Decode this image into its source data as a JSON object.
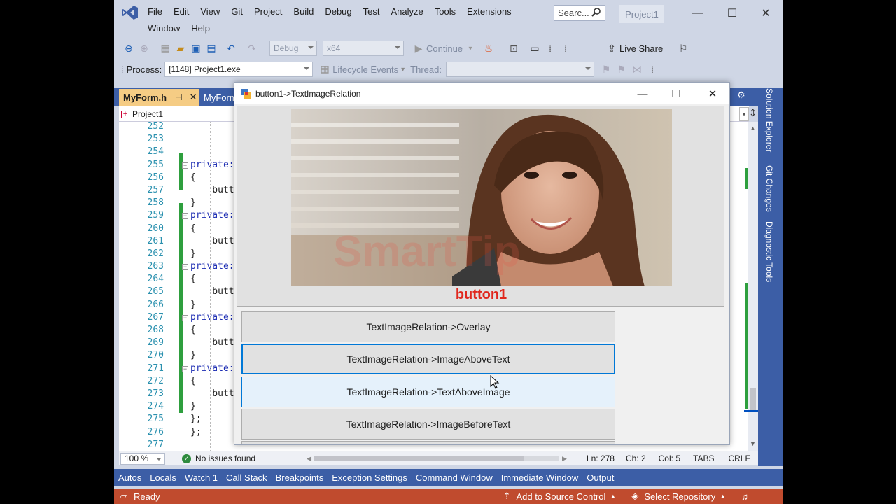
{
  "ide": {
    "menu_row1": [
      "File",
      "Edit",
      "View",
      "Git",
      "Project",
      "Build",
      "Debug",
      "Test",
      "Analyze",
      "Tools",
      "Extensions"
    ],
    "menu_row2": [
      "Window",
      "Help"
    ],
    "search_placeholder": "Searc...",
    "project_badge": "Project1",
    "toolbar": {
      "config": "Debug",
      "platform": "x64",
      "continue_label": "Continue",
      "live_share": "Live Share"
    },
    "debug_bar": {
      "process_label": "Process:",
      "process_value": "[1148] Project1.exe",
      "lifecycle_label": "Lifecycle Events",
      "thread_label": "Thread:"
    },
    "tabs": {
      "active": "MyForm.h",
      "pin": "⊣",
      "second": "MyForm"
    },
    "nav_combo": "Project1",
    "line_numbers": [
      "252",
      "253",
      "254",
      "255",
      "256",
      "257",
      "258",
      "259",
      "260",
      "261",
      "262",
      "263",
      "264",
      "265",
      "266",
      "267",
      "268",
      "269",
      "270",
      "271",
      "272",
      "273",
      "274",
      "275",
      "276",
      "277"
    ],
    "code_lines": [
      {
        "text": "",
        "kw": false
      },
      {
        "text": "",
        "kw": false
      },
      {
        "text": "",
        "kw": false
      },
      {
        "text": "private:",
        "kw": true
      },
      {
        "text": "{",
        "kw": false
      },
      {
        "text": "    butt",
        "kw": false
      },
      {
        "text": "}",
        "kw": false
      },
      {
        "text": "private:",
        "kw": true
      },
      {
        "text": "{",
        "kw": false
      },
      {
        "text": "    butt",
        "kw": false
      },
      {
        "text": "}",
        "kw": false
      },
      {
        "text": "private:",
        "kw": true
      },
      {
        "text": "{",
        "kw": false
      },
      {
        "text": "    butt",
        "kw": false
      },
      {
        "text": "}",
        "kw": false
      },
      {
        "text": "private:",
        "kw": true
      },
      {
        "text": "{",
        "kw": false
      },
      {
        "text": "    butt",
        "kw": false
      },
      {
        "text": "}",
        "kw": false
      },
      {
        "text": "private:",
        "kw": true
      },
      {
        "text": "{",
        "kw": false
      },
      {
        "text": "    butt",
        "kw": false
      },
      {
        "text": "}",
        "kw": false
      },
      {
        "text": "};",
        "kw": false
      },
      {
        "text": "};",
        "kw": false
      },
      {
        "text": "",
        "kw": false
      }
    ],
    "editor_status": {
      "zoom": "100 %",
      "issues": "No issues found",
      "ln": "Ln: 278",
      "ch": "Ch: 2",
      "col": "Col: 5",
      "tabs": "TABS",
      "eol": "CRLF"
    },
    "bottom_tabs": [
      "Autos",
      "Locals",
      "Watch 1",
      "Call Stack",
      "Breakpoints",
      "Exception Settings",
      "Command Window",
      "Immediate Window",
      "Output"
    ],
    "side_tabs": [
      "Solution Explorer",
      "Git Changes",
      "Diagnostic Tools"
    ],
    "statusbar": {
      "ready": "Ready",
      "source_control": "Add to Source Control",
      "repository": "Select Repository"
    }
  },
  "form": {
    "title": "button1->TextImageRelation",
    "big_button_label": "button1",
    "watermark": "SmartTip",
    "buttons": [
      "TextImageRelation->Overlay",
      "TextImageRelation->ImageAboveText",
      "TextImageRelation->TextAboveImage",
      "TextImageRelation->ImageBeforeText"
    ]
  },
  "colors": {
    "accent": "#0078d7",
    "status_bar": "#c04b2e",
    "tab_bar": "#3c5ea6",
    "button_text": "#e0281e"
  }
}
